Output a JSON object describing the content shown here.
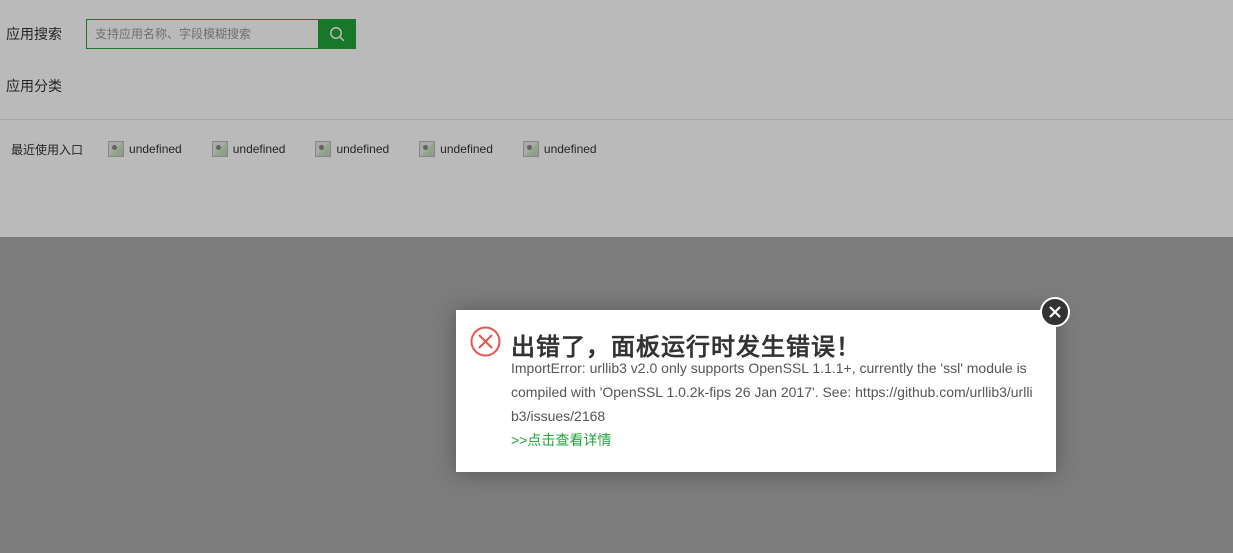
{
  "search": {
    "label": "应用搜索",
    "placeholder": "支持应用名称、字段模糊搜索",
    "value": ""
  },
  "category": {
    "label": "应用分类"
  },
  "recent": {
    "label": "最近使用入口",
    "items": [
      {
        "label": "undefined",
        "icon": "broken-image-icon"
      },
      {
        "label": "undefined",
        "icon": "broken-image-icon"
      },
      {
        "label": "undefined",
        "icon": "broken-image-icon"
      },
      {
        "label": "undefined",
        "icon": "broken-image-icon"
      },
      {
        "label": "undefined",
        "icon": "broken-image-icon"
      }
    ]
  },
  "error_dialog": {
    "icon": "error-circle-icon",
    "title": "出错了，面板运行时发生错误！",
    "message": "ImportError: urllib3 v2.0 only supports OpenSSL 1.1.1+, currently the 'ssl' module is compiled with 'OpenSSL 1.0.2k-fips 26 Jan 2017'. See: https://github.com/urllib3/urllib3/issues/2168",
    "details_link": ">>点击查看详情",
    "close_icon": "close-icon"
  },
  "colors": {
    "accent": "#20a53a",
    "error": "#e1574c",
    "overlay": "rgba(0,0,0,0.27)"
  }
}
